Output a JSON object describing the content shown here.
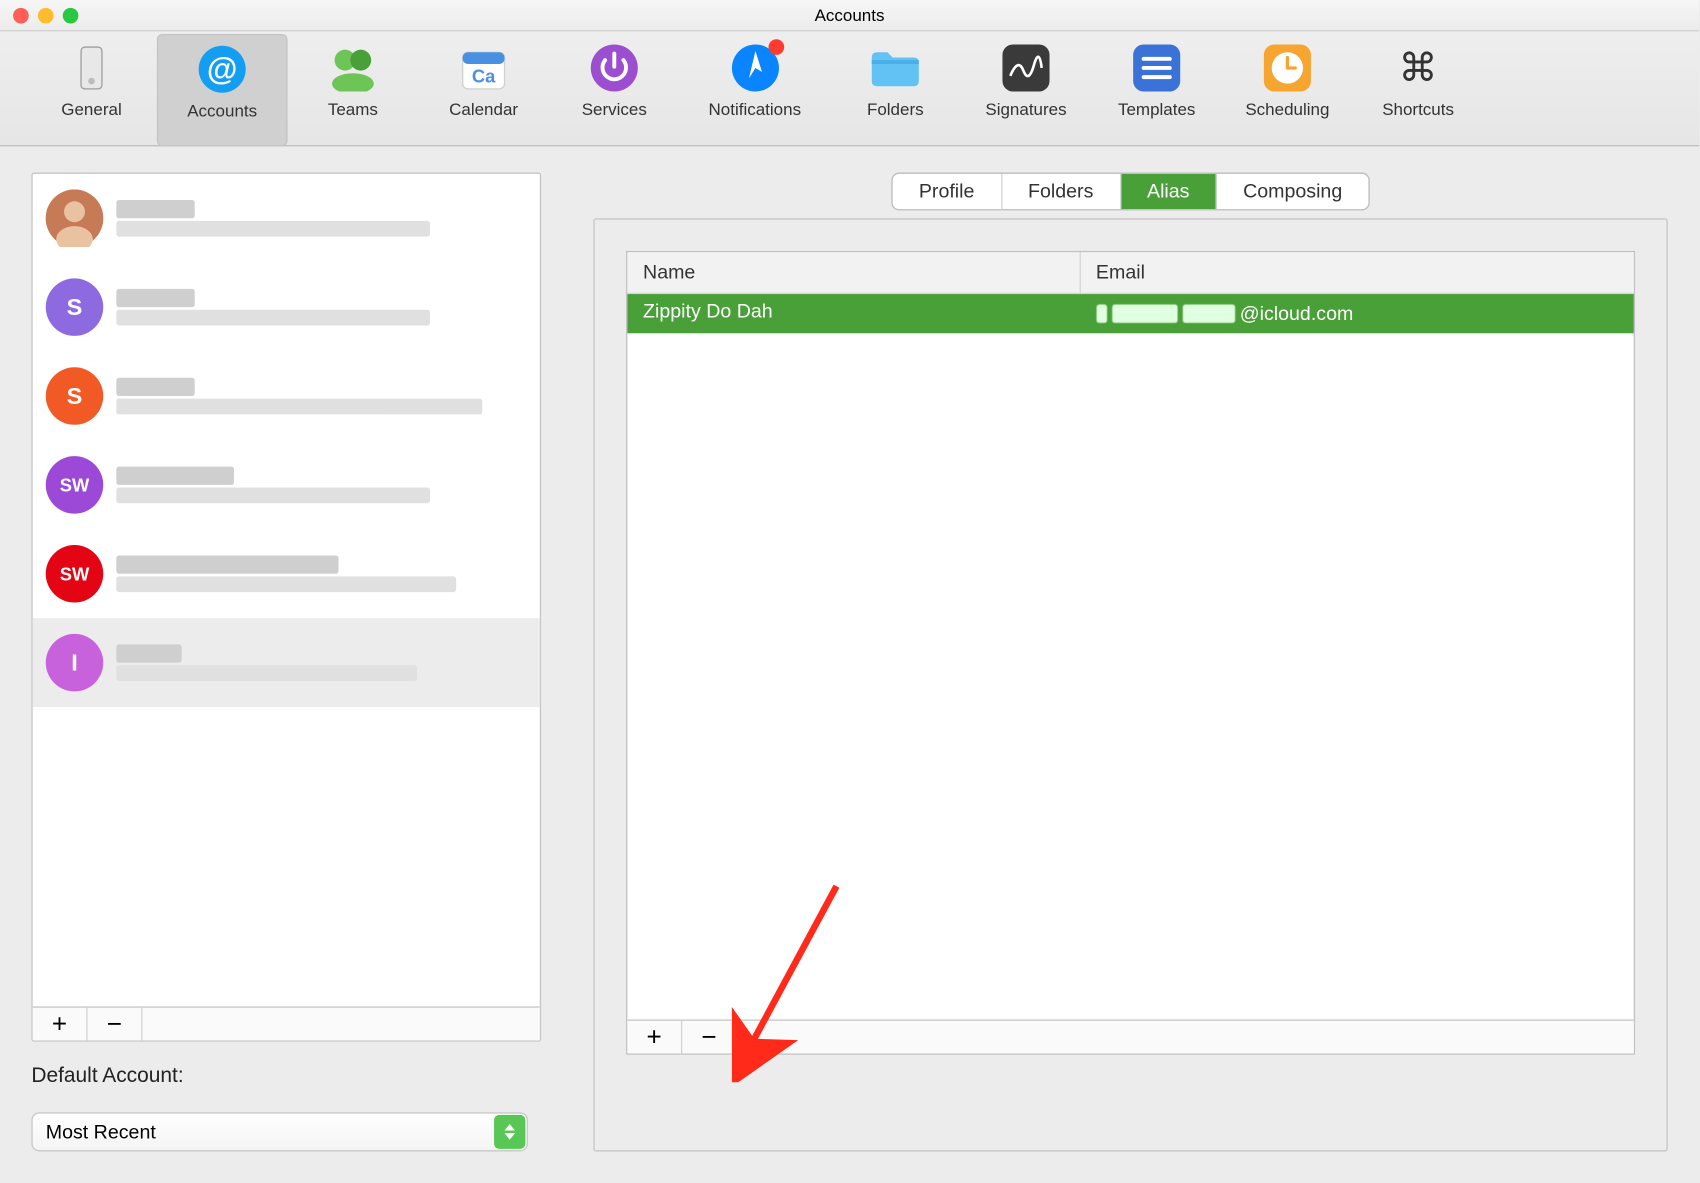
{
  "window": {
    "title": "Accounts"
  },
  "toolbar": {
    "items": [
      {
        "label": "General"
      },
      {
        "label": "Accounts"
      },
      {
        "label": "Teams"
      },
      {
        "label": "Calendar"
      },
      {
        "label": "Services"
      },
      {
        "label": "Notifications"
      },
      {
        "label": "Folders"
      },
      {
        "label": "Signatures"
      },
      {
        "label": "Templates"
      },
      {
        "label": "Scheduling"
      },
      {
        "label": "Shortcuts"
      }
    ]
  },
  "sidebar": {
    "accounts": [
      {
        "avatar_bg": "#c67a56",
        "avatar_text": ""
      },
      {
        "avatar_bg": "#8e6ae0",
        "avatar_text": "S"
      },
      {
        "avatar_bg": "#f15a24",
        "avatar_text": "S"
      },
      {
        "avatar_bg": "#9b49d6",
        "avatar_text": "SW"
      },
      {
        "avatar_bg": "#e30513",
        "avatar_text": "SW"
      },
      {
        "avatar_bg": "#c861dc",
        "avatar_text": "I",
        "selected": true
      }
    ]
  },
  "default_account": {
    "label": "Default Account:",
    "selected": "Most Recent"
  },
  "tabs": {
    "items": [
      {
        "label": "Profile"
      },
      {
        "label": "Folders"
      },
      {
        "label": "Alias",
        "selected": true
      },
      {
        "label": "Composing"
      }
    ]
  },
  "alias_table": {
    "columns": {
      "name": "Name",
      "email": "Email"
    },
    "rows": [
      {
        "name": "Zippity Do Dah",
        "email_suffix": "@icloud.com"
      }
    ]
  }
}
